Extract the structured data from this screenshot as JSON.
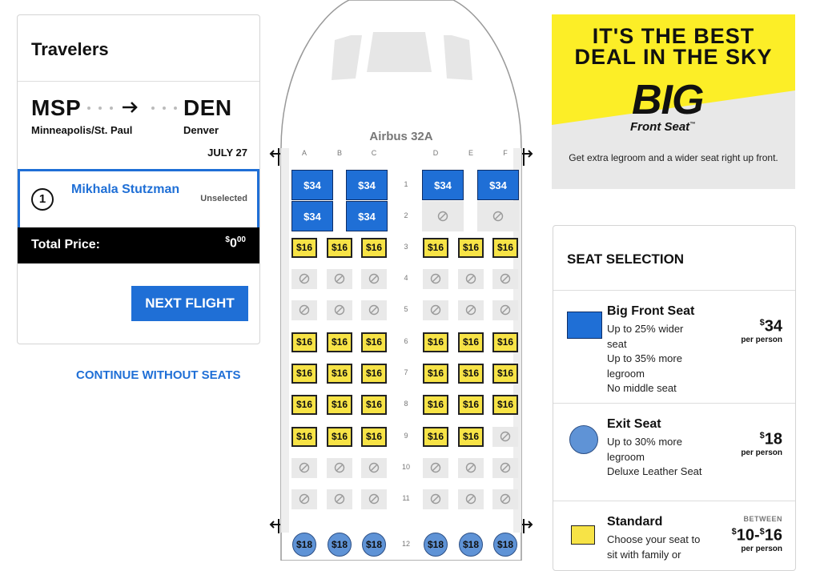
{
  "colors": {
    "accent": "#1f6fd6",
    "big_seat": "#1f6fd6",
    "standard": "#f7e346",
    "exit": "#5f93d6",
    "ad_yellow": "#fcee27"
  },
  "travelers": {
    "title": "Travelers",
    "origin_code": "MSP",
    "origin_city": "Minneapolis/St. Paul",
    "dest_code": "DEN",
    "dest_city": "Denver",
    "date": "JULY 27",
    "passenger_number": "1",
    "passenger_name": "Mikhala Stutzman",
    "passenger_status": "Unselected",
    "total_label": "Total Price:",
    "total_dollar": "$",
    "total_whole": "0",
    "total_cents": "00",
    "next_button": "NEXT FLIGHT"
  },
  "continue_link": "CONTINUE WITHOUT SEATS",
  "plane": {
    "model": "Airbus 32A",
    "columns": [
      "A",
      "B",
      "C",
      "D",
      "E",
      "F"
    ],
    "rows": [
      {
        "row": "1",
        "class": "big",
        "seats": [
          "$34",
          "$34",
          "$34",
          "$34"
        ]
      },
      {
        "row": "2",
        "class": "big",
        "seats": [
          "$34",
          "$34",
          "na",
          "na"
        ]
      },
      {
        "row": "3",
        "class": "std",
        "seats": [
          "$16",
          "$16",
          "$16",
          "$16",
          "$16",
          "$16"
        ]
      },
      {
        "row": "4",
        "class": "std",
        "seats": [
          "na",
          "na",
          "na",
          "na",
          "na",
          "na"
        ]
      },
      {
        "row": "5",
        "class": "std",
        "seats": [
          "na",
          "na",
          "na",
          "na",
          "na",
          "na"
        ]
      },
      {
        "row": "6",
        "class": "std",
        "seats": [
          "$16",
          "$16",
          "$16",
          "$16",
          "$16",
          "$16"
        ]
      },
      {
        "row": "7",
        "class": "std",
        "seats": [
          "$16",
          "$16",
          "$16",
          "$16",
          "$16",
          "$16"
        ]
      },
      {
        "row": "8",
        "class": "std",
        "seats": [
          "$16",
          "$16",
          "$16",
          "$16",
          "$16",
          "$16"
        ]
      },
      {
        "row": "9",
        "class": "std",
        "seats": [
          "$16",
          "$16",
          "$16",
          "$16",
          "$16",
          "na"
        ]
      },
      {
        "row": "10",
        "class": "std",
        "seats": [
          "na",
          "na",
          "na",
          "na",
          "na",
          "na"
        ]
      },
      {
        "row": "11",
        "class": "std",
        "seats": [
          "na",
          "na",
          "na",
          "na",
          "na",
          "na"
        ]
      },
      {
        "row": "12",
        "class": "exit",
        "seats": [
          "$18",
          "$18",
          "$18",
          "$18",
          "$18",
          "$18"
        ]
      }
    ]
  },
  "ad": {
    "headline_line1": "IT'S THE BEST",
    "headline_line2": "DEAL IN THE SKY",
    "brand_big": "BIG",
    "brand_sub": "Front Seat",
    "tm": "™",
    "subtext": "Get extra legroom and a wider seat right up front."
  },
  "seat_selection": {
    "title": "SEAT SELECTION",
    "options": [
      {
        "name": "Big Front Seat",
        "desc": [
          "Up to 25% wider seat",
          "Up to 35% more legroom",
          "No middle seat"
        ],
        "price_dollar": "$",
        "price": "34",
        "per": "per person"
      },
      {
        "name": "Exit Seat",
        "desc": [
          "Up to 30% more legroom",
          "Deluxe Leather Seat"
        ],
        "price_dollar": "$",
        "price": "18",
        "per": "per person"
      },
      {
        "name": "Standard",
        "desc": [
          "Choose your seat to sit with family or"
        ],
        "between": "BETWEEN",
        "price_low_dollar": "$",
        "price_low": "10",
        "price_dash": "-",
        "price_high_dollar": "$",
        "price_high": "16",
        "per": "per person"
      }
    ]
  }
}
